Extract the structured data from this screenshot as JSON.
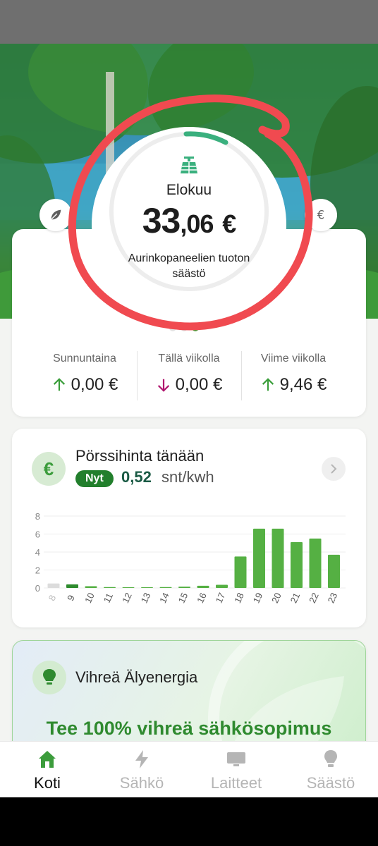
{
  "savings": {
    "month": "Elokuu",
    "amount_int": "33",
    "amount_dec": ",06",
    "currency": "€",
    "label": "Aurinkopaneelien tuoton säästö",
    "ring_progress": 0.08,
    "pager_pages": 3,
    "pager_active": 2,
    "stats": [
      {
        "label": "Sunnuntaina",
        "value": "0,00 €",
        "trend": "up"
      },
      {
        "label": "Tällä viikolla",
        "value": "0,00 €",
        "trend": "down"
      },
      {
        "label": "Viime viikolla",
        "value": "9,46 €",
        "trend": "up"
      }
    ]
  },
  "price": {
    "title": "Pörssihinta tänään",
    "now_label": "Nyt",
    "now_value": "0,52",
    "unit": "snt/kwh"
  },
  "chart_data": {
    "type": "bar",
    "categories": [
      "8",
      "9",
      "10",
      "11",
      "12",
      "13",
      "14",
      "15",
      "16",
      "17",
      "18",
      "19",
      "20",
      "21",
      "22",
      "23"
    ],
    "values": [
      0.5,
      0.4,
      0.2,
      0.1,
      0.05,
      0.0,
      0.1,
      0.15,
      0.25,
      0.35,
      3.5,
      6.6,
      6.6,
      5.1,
      5.5,
      3.7
    ],
    "y_ticks": [
      "0",
      "2",
      "4",
      "6",
      "8"
    ],
    "ylim": [
      0,
      8
    ],
    "past_categories": [
      "8"
    ],
    "current_category": "9",
    "grid": true,
    "colors": {
      "future": "#55b043",
      "current": "#2e8b2e",
      "past": "#dcdcdc"
    }
  },
  "green": {
    "title": "Vihreä Älyenergia",
    "cta": "Tee 100% vihreä sähkösopimus"
  },
  "nav": [
    {
      "label": "Koti",
      "icon": "home-icon",
      "active": true
    },
    {
      "label": "Sähkö",
      "icon": "bolt-icon",
      "active": false
    },
    {
      "label": "Laitteet",
      "icon": "monitor-icon",
      "active": false
    },
    {
      "label": "Säästö",
      "icon": "bulb-icon",
      "active": false
    }
  ],
  "colors": {
    "accent": "#2e8b2e",
    "brand_green": "#3c9c3c",
    "annotation_red": "#f04a50"
  }
}
